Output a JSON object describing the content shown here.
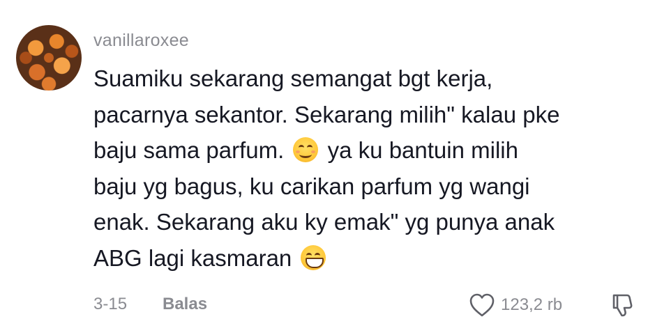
{
  "comment": {
    "username": "vanillaroxee",
    "lines": [
      "Suamiku sekarang semangat bgt kerja,",
      "pacarnya sekantor. Sekarang milih\" kalau pke",
      "baju sama parfum.",
      "ya ku bantuin milih",
      "baju yg bagus, ku carikan parfum yg wangi",
      "enak. Sekarang aku ky emak\" yg punya anak",
      "ABG lagi kasmaran"
    ],
    "date": "3-15",
    "reply_label": "Balas",
    "like_count": "123,2 rb",
    "icons": {
      "emoji_1": "smiling-face-with-smiling-eyes",
      "emoji_2": "grinning-face-with-smiling-eyes",
      "like": "heart-outline-icon",
      "dislike": "thumbs-down-outline-icon"
    }
  }
}
